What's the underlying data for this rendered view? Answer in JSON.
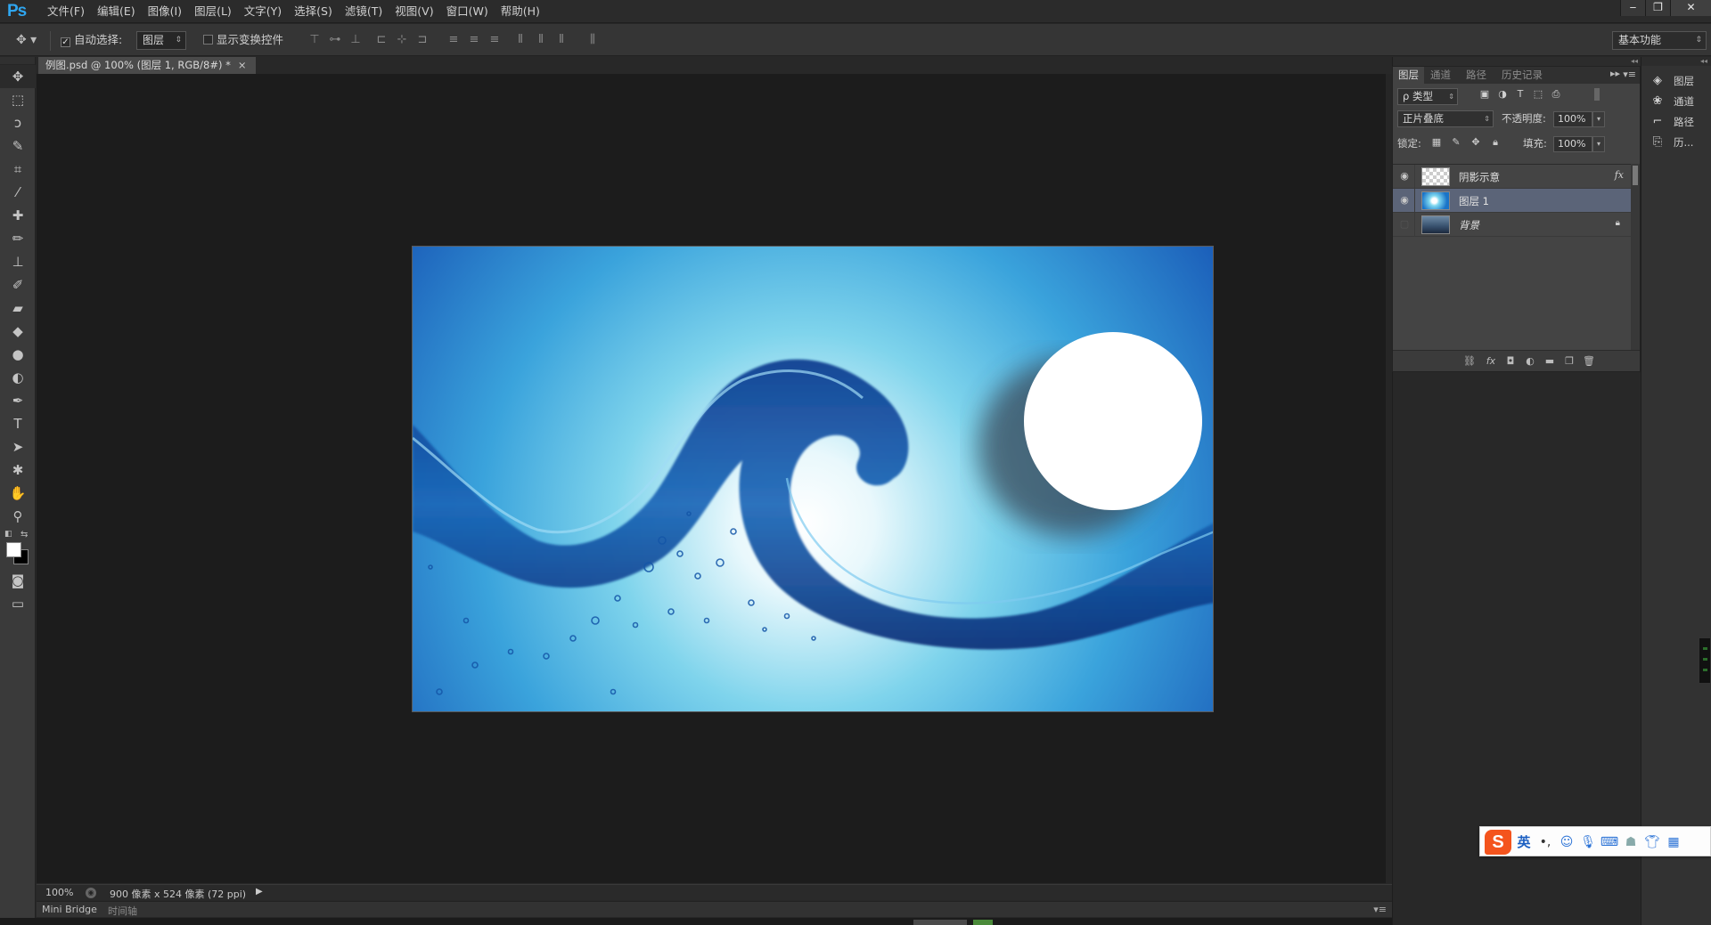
{
  "app": {
    "logo": "Ps",
    "menu": [
      "文件(F)",
      "编辑(E)",
      "图像(I)",
      "图层(L)",
      "文字(Y)",
      "选择(S)",
      "滤镜(T)",
      "视图(V)",
      "窗口(W)",
      "帮助(H)"
    ],
    "window_controls": {
      "minimize": "‒",
      "restore": "❐",
      "close": "✕"
    }
  },
  "options_bar": {
    "auto_select_label": "自动选择:",
    "auto_select_checked": true,
    "auto_select_target": "图层",
    "show_transform_label": "显示变换控件",
    "show_transform_checked": false,
    "workspace": "基本功能"
  },
  "document": {
    "tab_title": "例图.psd @ 100% (图层 1, RGB/8#) *",
    "tab_close": "×",
    "zoom": "100%",
    "info": "900 像素 x 524 像素 (72 ppi)"
  },
  "bottom_tabs": [
    "Mini Bridge",
    "时间轴"
  ],
  "tools": [
    {
      "icon": "move-tool-icon",
      "glyph": "✥",
      "active": true
    },
    {
      "icon": "marquee-tool-icon",
      "glyph": "⬚"
    },
    {
      "icon": "lasso-tool-icon",
      "glyph": "ↄ"
    },
    {
      "icon": "quick-select-tool-icon",
      "glyph": "✎"
    },
    {
      "icon": "crop-tool-icon",
      "glyph": "⌗"
    },
    {
      "icon": "eyedropper-tool-icon",
      "glyph": "⁄"
    },
    {
      "icon": "healing-brush-tool-icon",
      "glyph": "✚"
    },
    {
      "icon": "brush-tool-icon",
      "glyph": "✏"
    },
    {
      "icon": "clone-stamp-tool-icon",
      "glyph": "⊥"
    },
    {
      "icon": "history-brush-tool-icon",
      "glyph": "✐"
    },
    {
      "icon": "eraser-tool-icon",
      "glyph": "▰"
    },
    {
      "icon": "paint-bucket-tool-icon",
      "glyph": "◆"
    },
    {
      "icon": "blur-tool-icon",
      "glyph": "●"
    },
    {
      "icon": "dodge-tool-icon",
      "glyph": "◐"
    },
    {
      "icon": "pen-tool-icon",
      "glyph": "✒"
    },
    {
      "icon": "type-tool-icon",
      "glyph": "T"
    },
    {
      "icon": "path-select-tool-icon",
      "glyph": "➤"
    },
    {
      "icon": "shape-tool-icon",
      "glyph": "✱"
    },
    {
      "icon": "hand-tool-icon",
      "glyph": "✋"
    },
    {
      "icon": "zoom-tool-icon",
      "glyph": "⚲"
    }
  ],
  "colors": {
    "foreground": "#ffffff",
    "background": "#000000"
  },
  "layers_panel": {
    "tabs": [
      "图层",
      "通道",
      "路径",
      "历史记录"
    ],
    "active_tab": "图层",
    "filter_kind": "ρ 类型",
    "blend_mode": "正片叠底",
    "opacity_label": "不透明度:",
    "opacity": "100%",
    "lock_label": "锁定:",
    "fill_label": "填充:",
    "fill": "100%",
    "layers": [
      {
        "name": "阴影示意",
        "visible": true,
        "fx": "fx",
        "thumb": "checker",
        "selected": false
      },
      {
        "name": "图层 1",
        "visible": true,
        "thumb": "water",
        "selected": true
      },
      {
        "name": "背景",
        "visible": false,
        "locked": true,
        "thumb": "bg",
        "selected": false
      }
    ]
  },
  "dock": {
    "items": [
      {
        "label": "图层",
        "icon": "layers-icon",
        "glyph": "◈"
      },
      {
        "label": "通道",
        "icon": "channels-icon",
        "glyph": "❀"
      },
      {
        "label": "路径",
        "icon": "paths-icon",
        "glyph": "⌐"
      },
      {
        "label": "历...",
        "icon": "history-icon",
        "glyph": "⎘"
      }
    ]
  },
  "ime": {
    "logo": "S",
    "lang": "英",
    "punct": "•,"
  },
  "theme": {
    "accent": "#2fa6f0",
    "selected_layer": "#5b6478",
    "ime_orange": "#f4541d"
  }
}
